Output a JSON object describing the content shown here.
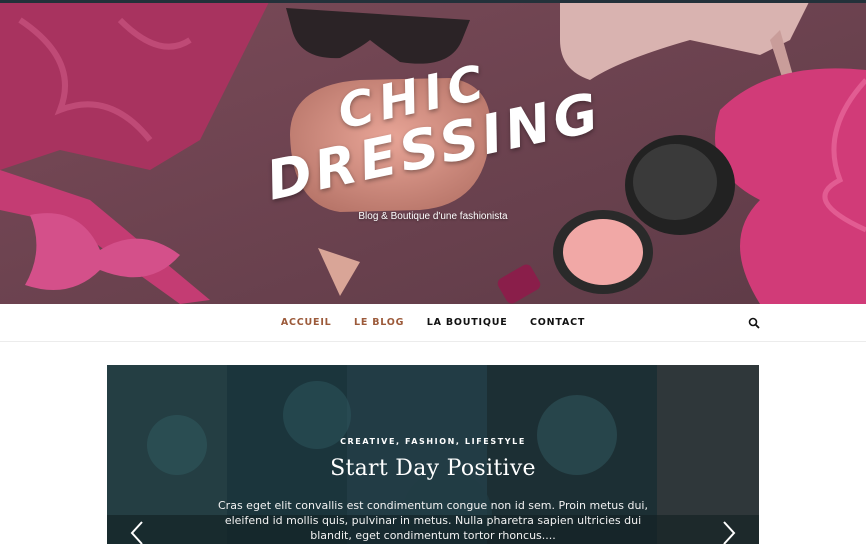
{
  "brand": {
    "logo_line1": "CHIC",
    "logo_line2": "DRESSING",
    "tagline": "Blog & Boutique d'une fashionista"
  },
  "nav": {
    "items": [
      {
        "label": "ACCUEIL",
        "active": true
      },
      {
        "label": "LE BLOG",
        "active": true
      },
      {
        "label": "LA BOUTIQUE",
        "active": false
      },
      {
        "label": "CONTACT",
        "active": false
      }
    ],
    "search_icon": "search-icon"
  },
  "slider": {
    "categories": "CREATIVE, FASHION, LIFESTYLE",
    "title": "Start Day Positive",
    "excerpt": "Cras eget elit convallis est condimentum congue non id sem. Proin metus dui, eleifend id mollis quis, pulvinar in metus. Nulla pharetra sapien ultricies dui blandit, eget condimentum tortor rhoncus....",
    "prev_icon": "chevron-left-icon",
    "next_icon": "chevron-right-icon"
  },
  "colors": {
    "accent": "#9c5a3a",
    "hero_bg": "#6e4452",
    "slider_bg": "#1d3236"
  }
}
